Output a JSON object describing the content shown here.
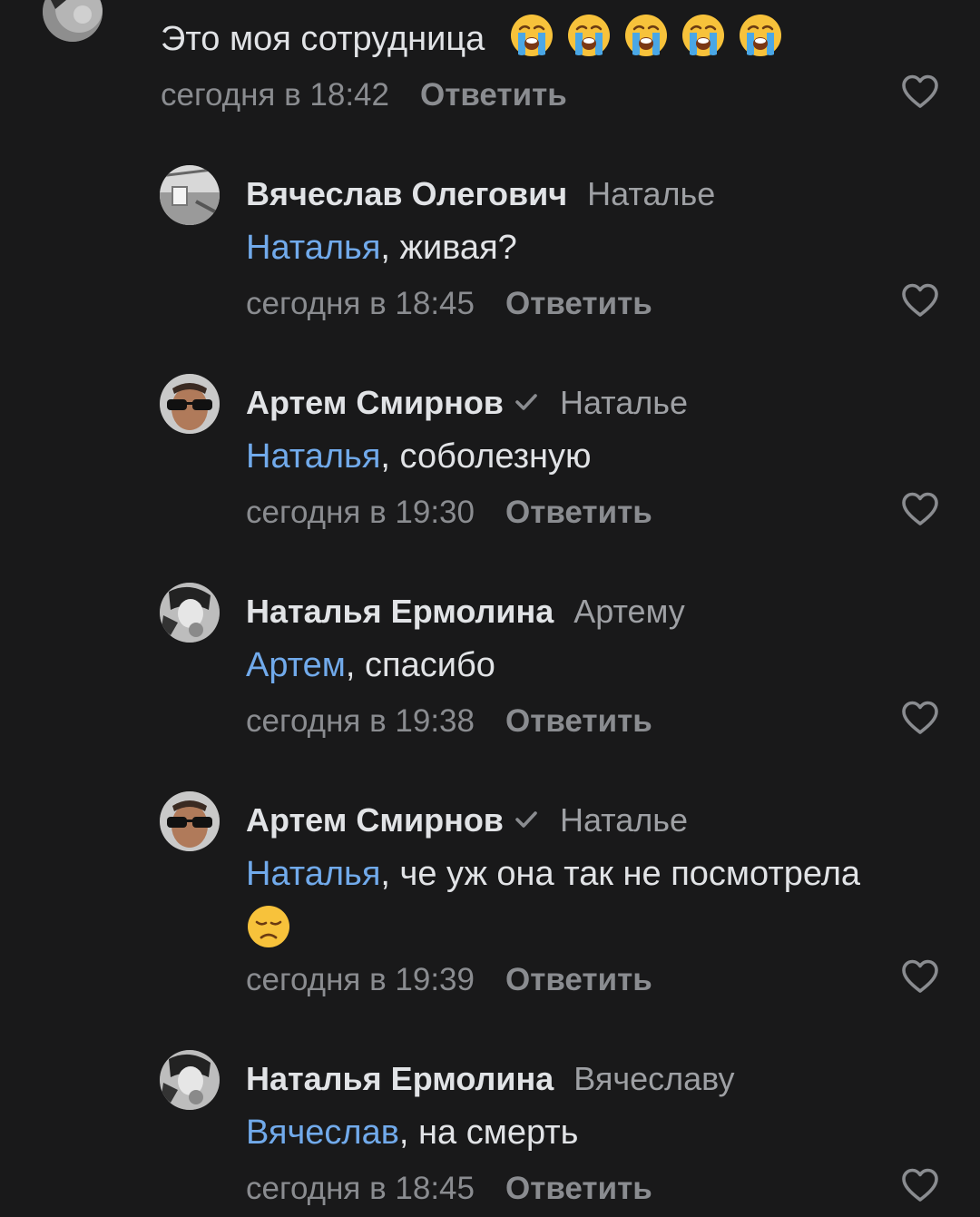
{
  "colors": {
    "background": "#19191a",
    "text": "#e1e3e6",
    "secondary": "#9ea0a4",
    "mention": "#71aaeb"
  },
  "top_comment": {
    "text": "Это моя сотрудница",
    "emoji": [
      "loudly-crying-face",
      "loudly-crying-face",
      "loudly-crying-face",
      "loudly-crying-face",
      "loudly-crying-face"
    ],
    "date": "сегодня в 18:42",
    "reply_label": "Ответить"
  },
  "replies": [
    {
      "author": "Вячеслав Олегович",
      "verified": false,
      "recipient": "Наталье",
      "mention": "Наталья",
      "text": ", живая?",
      "date": "сегодня в 18:45",
      "reply_label": "Ответить"
    },
    {
      "author": "Артем Смирнов",
      "verified": true,
      "recipient": "Наталье",
      "mention": "Наталья",
      "text": ", соболезную",
      "date": "сегодня в 19:30",
      "reply_label": "Ответить"
    },
    {
      "author": "Наталья Ермолина",
      "verified": false,
      "recipient": "Артему",
      "mention": "Артем",
      "text": ", спасибо",
      "date": "сегодня в 19:38",
      "reply_label": "Ответить"
    },
    {
      "author": "Артем Смирнов",
      "verified": true,
      "recipient": "Наталье",
      "mention": "Наталья",
      "text": ", че уж она так не посмотрела",
      "emoji": "disappointed-face",
      "date": "сегодня в 19:39",
      "reply_label": "Ответить"
    },
    {
      "author": "Наталья Ермолина",
      "verified": false,
      "recipient": "Вячеславу",
      "mention": "Вячеслав",
      "text": ", на смерть",
      "date": "сегодня в 18:45",
      "reply_label": "Ответить"
    }
  ]
}
